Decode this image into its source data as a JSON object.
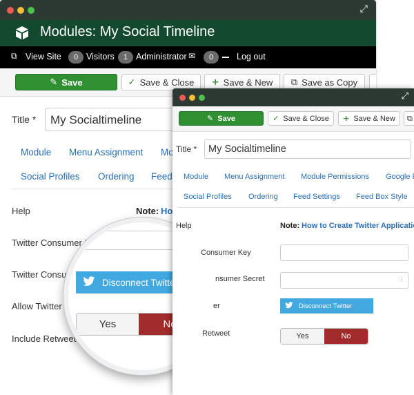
{
  "back_window": {
    "header_title": "Modules: My Social Timeline",
    "admin_bar": {
      "view_site": "View Site",
      "visitors_count": "0",
      "visitors_label": "Visitors",
      "admin_count": "1",
      "admin_label": "Administrator",
      "messages_count": "0",
      "logout": "Log out"
    },
    "toolbar": {
      "save": "Save",
      "save_close": "Save & Close",
      "save_new": "Save & New",
      "save_copy": "Save as Copy"
    },
    "title_label": "Title *",
    "title_value": "My Socialtimeline",
    "tabs_row1": [
      "Module",
      "Menu Assignment",
      "Mo"
    ],
    "tabs_row2": [
      "Social Profiles",
      "Ordering",
      "Feed"
    ],
    "help_label": "Help",
    "note_label": "Note:",
    "note_link": "Ho",
    "field_labels": [
      "Twitter Consumer K",
      "Twitter Consu",
      "Allow Twitter",
      "Include Retweet"
    ]
  },
  "magnifier": {
    "twitter_button": "Disconnect Twitter",
    "yes": "Yes",
    "no": "No"
  },
  "front_window": {
    "toolbar": {
      "save": "Save",
      "save_close": "Save & Close",
      "save_new": "Save & New"
    },
    "title_label": "Title *",
    "title_value": "My Socialtimeline",
    "tabs_row1": [
      "Module",
      "Menu Assignment",
      "Module Permissions",
      "Google F"
    ],
    "tabs_row2": [
      "Social Profiles",
      "Ordering",
      "Feed Settings",
      "Feed Box Style"
    ],
    "help_label": "Help",
    "note_label": "Note:",
    "note_link": "How to Create Twitter Applicatio",
    "field_labels": [
      "Consumer Key",
      "nsumer Secret",
      "er",
      "Retweet"
    ],
    "twitter_button": "Disconnect Twitter",
    "yes": "Yes",
    "no": "No"
  },
  "colors": {
    "titlebar": "#2c3a33",
    "header": "#134a2d",
    "save_green": "#2f8f31",
    "link_blue": "#2a6fb7",
    "twitter_blue": "#41a8e0",
    "no_red": "#a12a2a"
  },
  "icons": {
    "module": "cube-icon",
    "view_site": "external-link-icon",
    "save": "edit-icon",
    "save_close": "check-icon",
    "save_new": "plus-icon",
    "save_copy": "copy-icon",
    "twitter": "twitter-bird-icon",
    "expand": "expand-icon"
  }
}
